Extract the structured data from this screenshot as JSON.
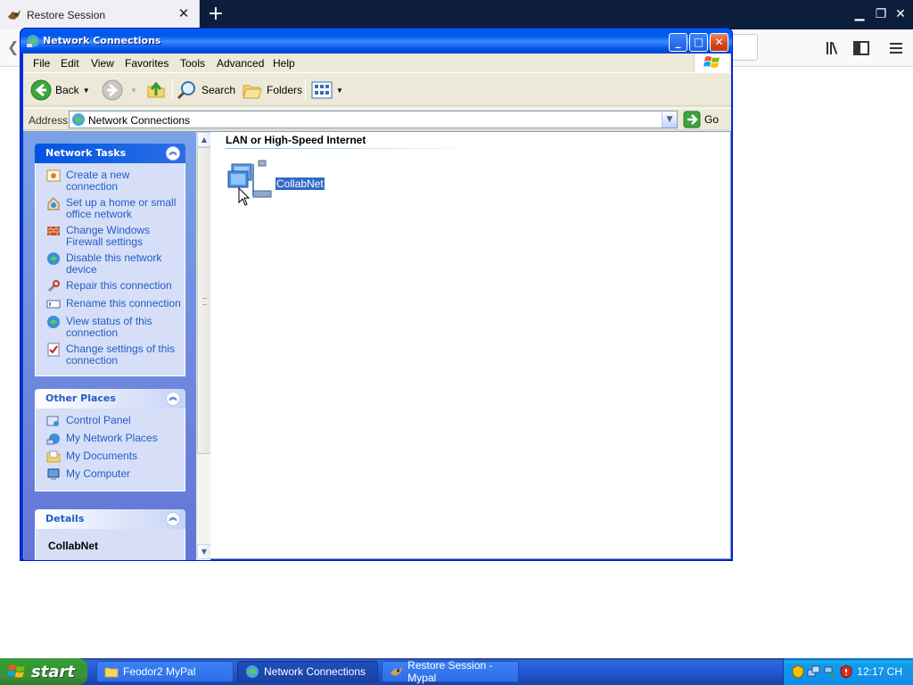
{
  "browser": {
    "tab_title": "Restore Session",
    "new_tab": "+",
    "tab_close": "✕"
  },
  "window": {
    "title": "Network Connections",
    "menu": [
      "File",
      "Edit",
      "View",
      "Favorites",
      "Tools",
      "Advanced",
      "Help"
    ],
    "toolbar": {
      "back": "Back",
      "search": "Search",
      "folders": "Folders"
    },
    "address": {
      "label": "Address",
      "value": "Network Connections",
      "go": "Go"
    }
  },
  "taskpane": {
    "network_tasks": {
      "title": "Network Tasks",
      "items": [
        "Create a new connection",
        "Set up a home or small office network",
        "Change Windows Firewall settings",
        "Disable this network device",
        "Repair this connection",
        "Rename this connection",
        "View status of this connection",
        "Change settings of this connection"
      ]
    },
    "other_places": {
      "title": "Other Places",
      "items": [
        "Control Panel",
        "My Network Places",
        "My Documents",
        "My Computer"
      ]
    },
    "details": {
      "title": "Details",
      "name": "CollabNet"
    }
  },
  "files": {
    "group": "LAN or High-Speed Internet",
    "items": [
      {
        "label": "CollabNet",
        "icon": "network-connection-icon",
        "selected": true
      }
    ]
  },
  "taskbar": {
    "start": "start",
    "buttons": [
      {
        "label": "Feodor2 MyPal",
        "icon": "folder-icon",
        "active": false
      },
      {
        "label": "Network Connections",
        "icon": "network-connections-icon",
        "active": true
      },
      {
        "label": "Restore Session - Mypal",
        "icon": "mypal-icon",
        "active": false
      }
    ],
    "clock": "12:17 CH"
  }
}
